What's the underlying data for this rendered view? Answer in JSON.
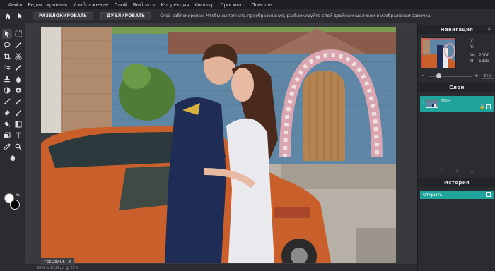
{
  "menu": [
    "Файл",
    "Редактировать",
    "Изображение",
    "Слой",
    "Выбрать",
    "Коррекция",
    "Фильтр",
    "Просмотр",
    "Помощь"
  ],
  "options_bar": {
    "unlock_button": "РАЗБЛОКИРОВАТЬ",
    "duplicate_button": "ДУБЛИРОВАТЬ",
    "message": "Слой заблокирован. Чтобы выполнить преобразования, разблокируйте слой двойным щелчком в изображении замочка."
  },
  "tools": [
    "move-tool",
    "marquee-tool",
    "lasso-tool",
    "magic-wand-tool",
    "crop-tool",
    "slice-tool",
    "healing-tool",
    "patch-tool",
    "stamp-tool",
    "dropper-tool",
    "dodge-tool",
    "blur-tool",
    "brush-tool",
    "pencil-tool",
    "eraser-tool",
    "smudge-tool",
    "bucket-tool",
    "gradient-tool",
    "shape-tool",
    "text-tool",
    "picker-tool",
    "zoom-tool",
    "hand-tool"
  ],
  "colors": {
    "accent": "#1fa39a",
    "foreground_swatch": "#ffffff",
    "background_swatch": "#000000"
  },
  "navigator": {
    "title": "Навигация",
    "x_label": "X:",
    "y_label": "Y:",
    "w_label": "W:",
    "w_value": "2000",
    "h_label": "H:",
    "h_value": "1333",
    "zoom_minus": "-",
    "zoom_plus": "+",
    "zoom_value": "55%"
  },
  "layers": {
    "title": "Слои",
    "items": [
      {
        "name": "Фон",
        "locked": true,
        "visible": true
      }
    ]
  },
  "history": {
    "title": "История",
    "items": [
      "Открыть"
    ]
  },
  "statusbar": {
    "feedback": "FEEDBACK",
    "feedback_close": "x",
    "doc_info": "2000 x 1333 px @ 55%"
  }
}
